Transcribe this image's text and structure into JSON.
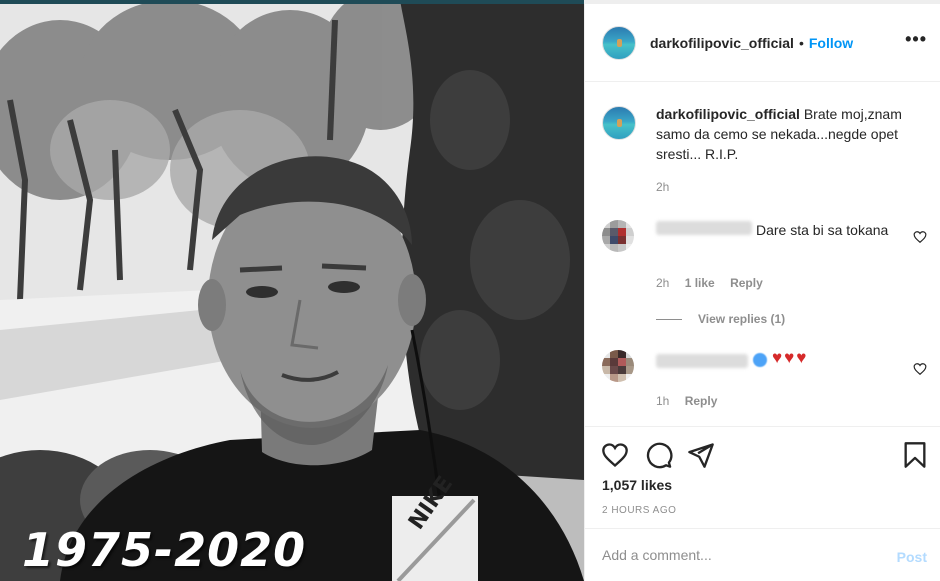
{
  "post": {
    "photo_caption": "1975-2020",
    "logo_text": "NIKE"
  },
  "header": {
    "username": "darkofilipovic_official",
    "separator": "•",
    "follow_label": "Follow",
    "more_glyph": "•••"
  },
  "caption": {
    "username": "darkofilipovic_official",
    "text": "Brate moj,znam samo da cemo se nekada...negde opet sresti... R.I.P.",
    "time": "2h"
  },
  "comments": [
    {
      "text": "Dare sta bi sa tokana",
      "time": "2h",
      "likes": "1 like",
      "reply_label": "Reply",
      "view_replies": "View replies (1)"
    },
    {
      "hearts": "♥♥♥",
      "time": "1h",
      "reply_label": "Reply"
    }
  ],
  "actions": {
    "icons": [
      "heart-icon",
      "comment-icon",
      "share-icon",
      "bookmark-icon"
    ],
    "likes": "1,057 likes",
    "post_time": "2 HOURS AGO"
  },
  "add_comment": {
    "placeholder": "Add a comment...",
    "post_label": "Post"
  },
  "colors": {
    "follow": "#0095f6",
    "post_disabled": "#b3dbff",
    "meta_gray": "#8e8e8e",
    "heart_red": "#d62a2a"
  }
}
